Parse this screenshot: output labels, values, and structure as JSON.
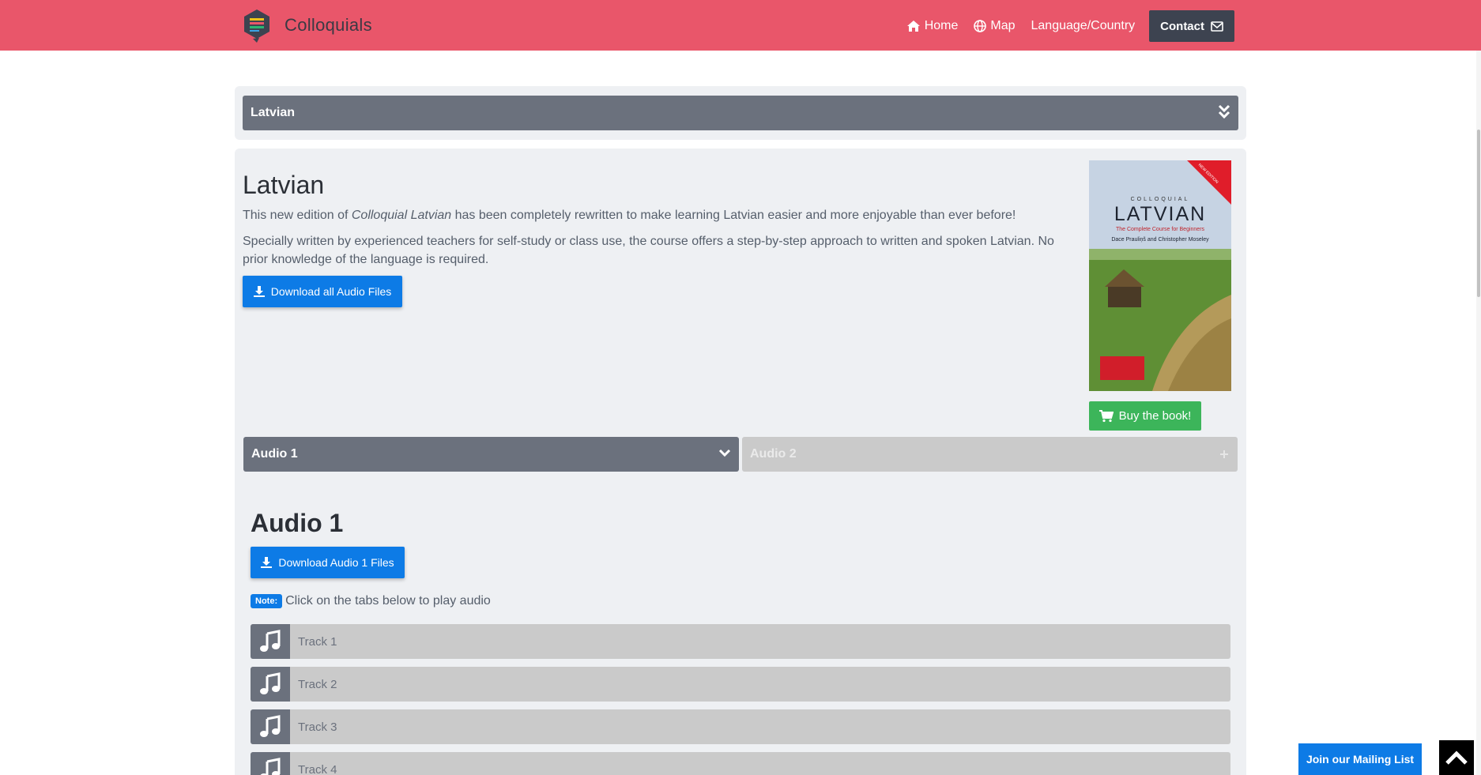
{
  "navbar": {
    "brand": "Colloquials",
    "links": [
      {
        "label": "Home",
        "icon": "home-icon"
      },
      {
        "label": "Map",
        "icon": "globe-icon"
      },
      {
        "label": "Language/Country",
        "icon": ""
      }
    ],
    "contact_label": "Contact",
    "colors": {
      "background": "#e9566a",
      "contact_bg": "#3d4350"
    }
  },
  "language_select": {
    "selected": "Latvian",
    "icon": "double-chevron-down-icon"
  },
  "course": {
    "title": "Latvian",
    "desc1_pre": "This new edition of ",
    "desc1_em": "Colloquial Latvian",
    "desc1_post": " has been completely rewritten to make learning Latvian easier and more enjoyable than ever before!",
    "desc2": "Specially written by experienced teachers for self-study or class use, the course offers a step-by-step approach to written and spoken Latvian. No prior knowledge of the language is required.",
    "download_all_label": "Download all Audio Files",
    "buy_label": "Buy the book!",
    "book_cover": {
      "series": "COLLOQUIAL",
      "title": "LATVIAN",
      "subtitle": "The Complete Course for Beginners",
      "authors": "Dace Prauliņš and Christopher Moseley",
      "ribbon": "NEW EDITION"
    }
  },
  "tabs": [
    {
      "label": "Audio 1",
      "active": true,
      "icon": "chevron-down-icon"
    },
    {
      "label": "Audio 2",
      "active": false,
      "icon": "plus-icon"
    }
  ],
  "audio_section": {
    "title": "Audio 1",
    "download_label": "Download Audio 1 Files",
    "note_badge": "Note:",
    "note_text": "Click on the tabs below to play audio",
    "tracks": [
      "Track 1",
      "Track 2",
      "Track 3",
      "Track 4"
    ]
  },
  "floating": {
    "mailing_label": "Join our Mailing List",
    "back_to_top_icon": "chevron-up-icon"
  },
  "colors": {
    "accent_blue": "#0d7be6",
    "buy_green": "#3cb55a",
    "tab_active": "#6b717d",
    "tab_inactive": "#cacaca"
  }
}
